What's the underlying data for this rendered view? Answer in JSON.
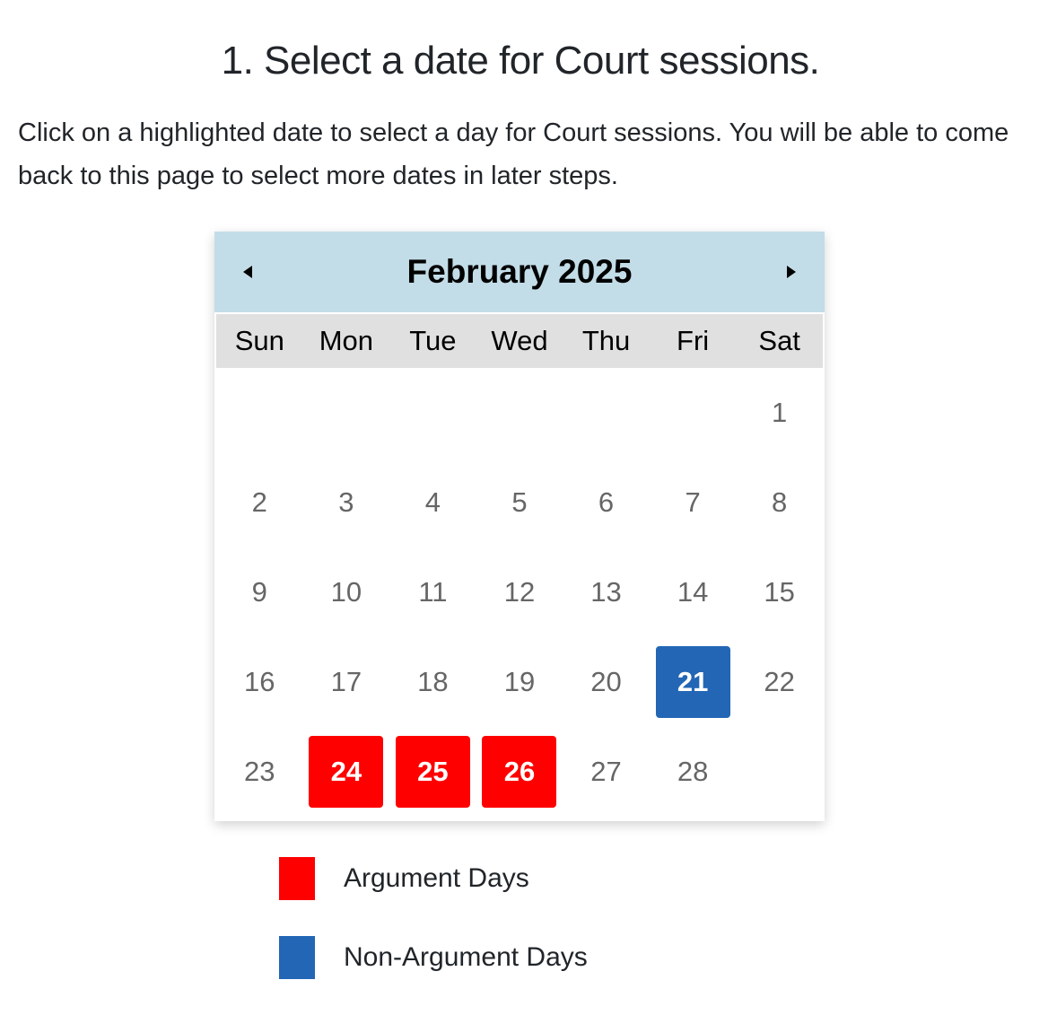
{
  "page": {
    "title": "1. Select a date for Court sessions.",
    "intro": "Click on a highlighted date to select a day for Court sessions. You will be able to come back to this page to select more dates in later steps."
  },
  "calendar": {
    "month_label": "February 2025",
    "prev_icon": "triangle-left-icon",
    "next_icon": "triangle-right-icon",
    "weekdays": [
      "Sun",
      "Mon",
      "Tue",
      "Wed",
      "Thu",
      "Fri",
      "Sat"
    ],
    "weeks": [
      [
        {
          "d": ""
        },
        {
          "d": ""
        },
        {
          "d": ""
        },
        {
          "d": ""
        },
        {
          "d": ""
        },
        {
          "d": ""
        },
        {
          "d": "1"
        }
      ],
      [
        {
          "d": "2"
        },
        {
          "d": "3"
        },
        {
          "d": "4"
        },
        {
          "d": "5"
        },
        {
          "d": "6"
        },
        {
          "d": "7"
        },
        {
          "d": "8"
        }
      ],
      [
        {
          "d": "9"
        },
        {
          "d": "10"
        },
        {
          "d": "11"
        },
        {
          "d": "12"
        },
        {
          "d": "13"
        },
        {
          "d": "14"
        },
        {
          "d": "15"
        }
      ],
      [
        {
          "d": "16"
        },
        {
          "d": "17"
        },
        {
          "d": "18"
        },
        {
          "d": "19"
        },
        {
          "d": "20"
        },
        {
          "d": "21",
          "type": "non-argument"
        },
        {
          "d": "22"
        }
      ],
      [
        {
          "d": "23"
        },
        {
          "d": "24",
          "type": "argument"
        },
        {
          "d": "25",
          "type": "argument"
        },
        {
          "d": "26",
          "type": "argument"
        },
        {
          "d": "27"
        },
        {
          "d": "28"
        },
        {
          "d": ""
        }
      ]
    ]
  },
  "legend": [
    {
      "label": "Argument Days",
      "color": "#ff0000"
    },
    {
      "label": "Non-Argument Days",
      "color": "#2366b5"
    }
  ],
  "colors": {
    "header_bg": "#c3dde8",
    "weekday_bg": "#e0e0e0",
    "argument": "#ff0000",
    "non_argument": "#2366b5"
  }
}
